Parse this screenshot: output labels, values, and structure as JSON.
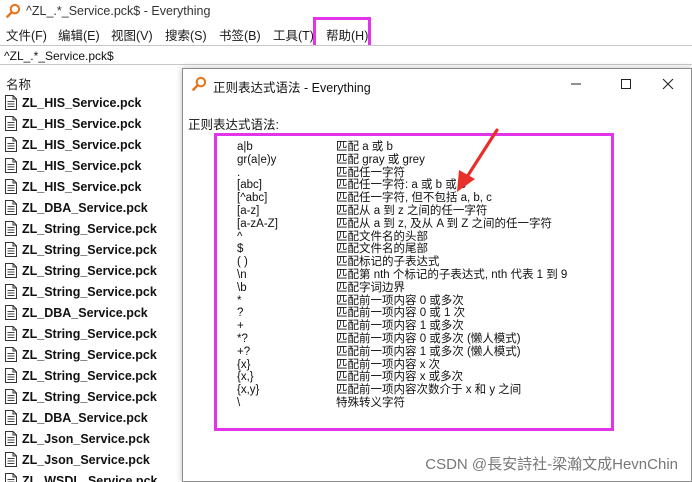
{
  "window": {
    "title": "^ZL_.*_Service.pck$ - Everything"
  },
  "menu": [
    {
      "label": "文件(F)"
    },
    {
      "label": "编辑(E)"
    },
    {
      "label": "视图(V)"
    },
    {
      "label": "搜索(S)"
    },
    {
      "label": "书签(B)"
    },
    {
      "label": "工具(T)"
    },
    {
      "label": "帮助(H)"
    }
  ],
  "search": {
    "value": "^ZL_.*_Service.pck$"
  },
  "list": {
    "header": "名称",
    "files": [
      "ZL_HIS_Service.pck",
      "ZL_HIS_Service.pck",
      "ZL_HIS_Service.pck",
      "ZL_HIS_Service.pck",
      "ZL_HIS_Service.pck",
      "ZL_DBA_Service.pck",
      "ZL_String_Service.pck",
      "ZL_String_Service.pck",
      "ZL_String_Service.pck",
      "ZL_String_Service.pck",
      "ZL_DBA_Service.pck",
      "ZL_String_Service.pck",
      "ZL_String_Service.pck",
      "ZL_String_Service.pck",
      "ZL_String_Service.pck",
      "ZL_DBA_Service.pck",
      "ZL_Json_Service.pck",
      "ZL_Json_Service.pck",
      "ZL_WSDL_Service.pck"
    ]
  },
  "dialog": {
    "title": "正则表达式语法 - Everything",
    "heading": "正则表达式语法:",
    "rows": [
      {
        "pattern": "a|b",
        "desc": "匹配 a 或 b"
      },
      {
        "pattern": "gr(a|e)y",
        "desc": "匹配 gray 或 grey"
      },
      {
        "pattern": ".",
        "desc": "匹配任一字符"
      },
      {
        "pattern": "[abc]",
        "desc": "匹配任一字符: a 或 b 或 c"
      },
      {
        "pattern": "[^abc]",
        "desc": "匹配任一字符, 但不包括 a, b, c"
      },
      {
        "pattern": "[a-z]",
        "desc": "匹配从 a 到 z 之间的任一字符"
      },
      {
        "pattern": "[a-zA-Z]",
        "desc": "匹配从 a 到 z, 及从 A 到 Z 之间的任一字符"
      },
      {
        "pattern": "^",
        "desc": "匹配文件名的头部"
      },
      {
        "pattern": "$",
        "desc": "匹配文件名的尾部"
      },
      {
        "pattern": "( )",
        "desc": "匹配标记的子表达式"
      },
      {
        "pattern": "\\n",
        "desc": "匹配第 nth 个标记的子表达式, nth 代表 1 到 9"
      },
      {
        "pattern": "\\b",
        "desc": "匹配字词边界"
      },
      {
        "pattern": "*",
        "desc": "匹配前一项内容 0 或多次"
      },
      {
        "pattern": "?",
        "desc": "匹配前一项内容 0 或 1 次"
      },
      {
        "pattern": "+",
        "desc": "匹配前一项内容 1 或多次"
      },
      {
        "pattern": "*?",
        "desc": "匹配前一项内容 0 或多次 (懒人模式)"
      },
      {
        "pattern": "+?",
        "desc": "匹配前一项内容 1 或多次 (懒人模式)"
      },
      {
        "pattern": "{x}",
        "desc": "匹配前一项内容 x 次"
      },
      {
        "pattern": "{x,}",
        "desc": "匹配前一项内容 x 或多次"
      },
      {
        "pattern": "{x,y}",
        "desc": "匹配前一项内容次数介于 x 和 y 之间"
      },
      {
        "pattern": "\\",
        "desc": "特殊转义字符"
      }
    ]
  },
  "watermark": "CSDN @長安詩社-梁瀚文成HevnChin",
  "colors": {
    "highlight": "#e234e8",
    "arrow": "#e8302a",
    "icon_orange": "#e8731a"
  }
}
